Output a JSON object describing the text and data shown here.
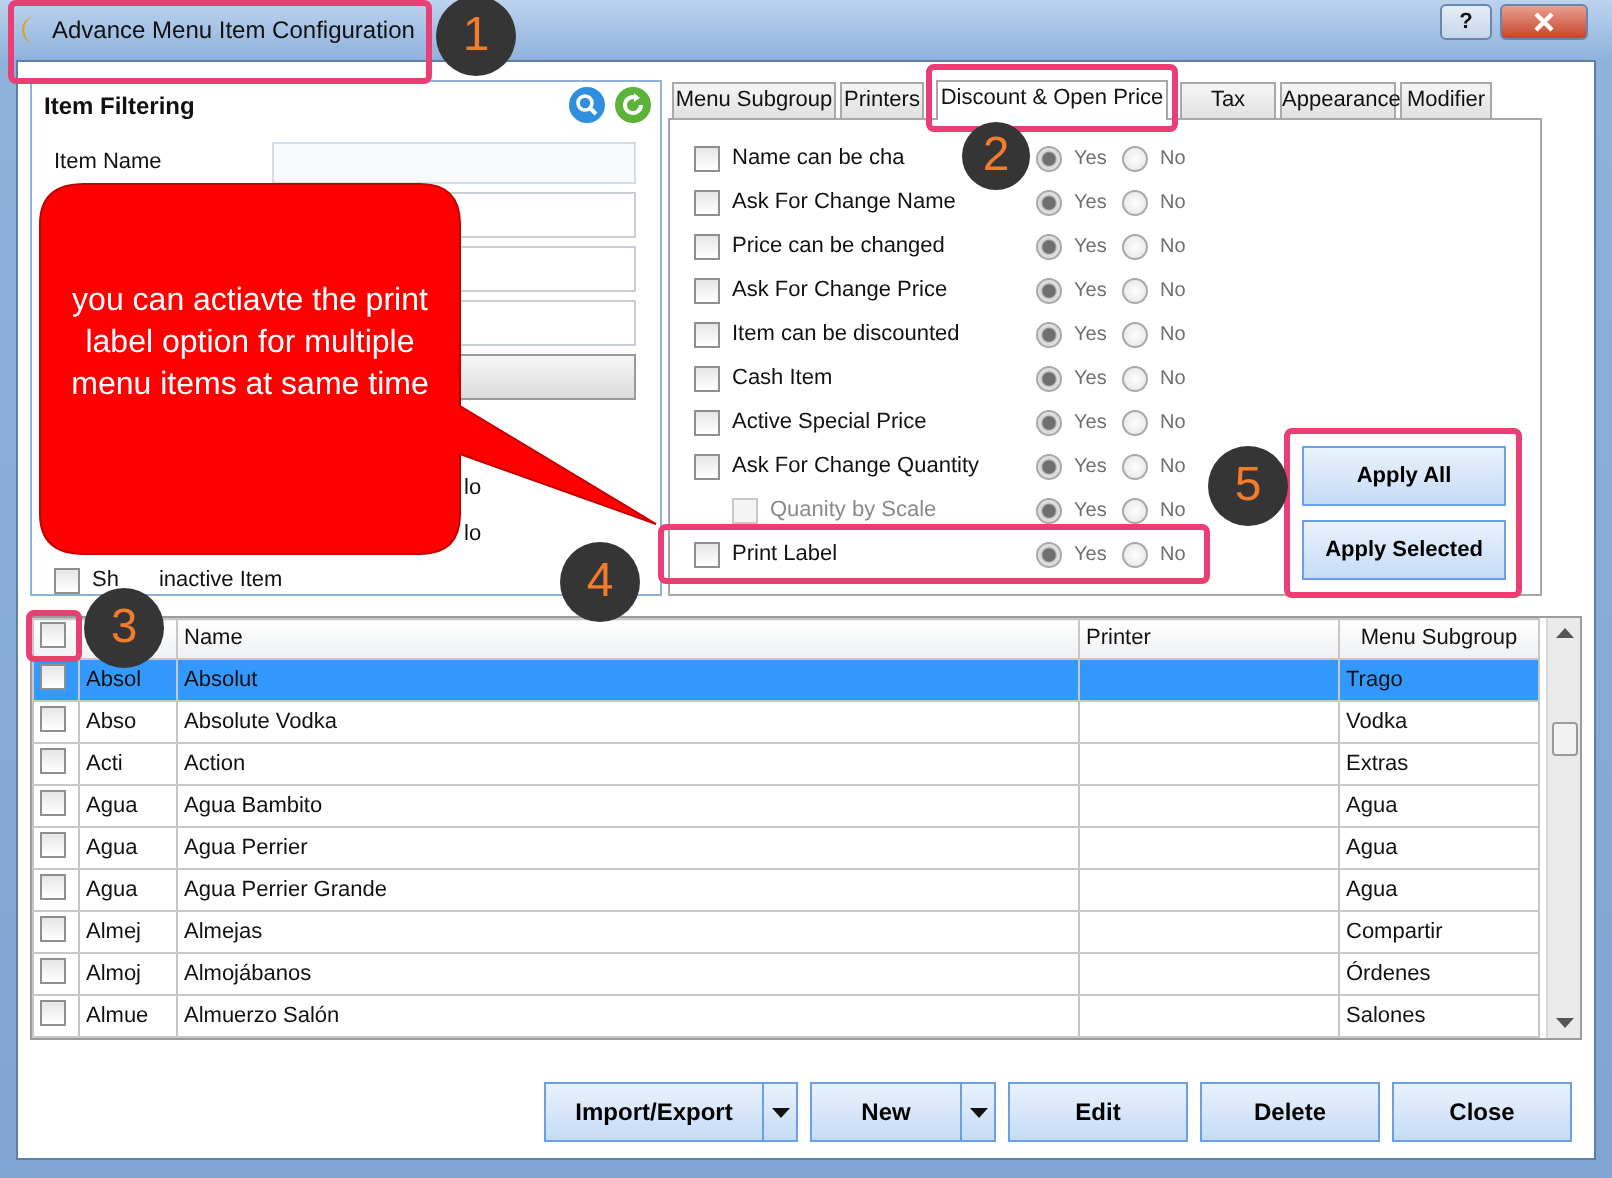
{
  "window": {
    "title": "Advance Menu Item Configuration",
    "help_label": "?"
  },
  "filter": {
    "title": "Item Filtering",
    "item_name_label": "Item Name",
    "fragments": [
      "lo",
      "lo"
    ],
    "show_inactive": {
      "label_start": "Sh",
      "label_end": "inactive Item",
      "checked": false
    }
  },
  "tabs": [
    {
      "label": "Menu Subgroup",
      "selected": false
    },
    {
      "label": "Printers",
      "selected": false
    },
    {
      "label": "Discount & Open Price",
      "selected": true
    },
    {
      "label": "Tax",
      "selected": false
    },
    {
      "label": "Appearance",
      "selected": false
    },
    {
      "label": "Modifier",
      "selected": false
    }
  ],
  "options": [
    {
      "label": "Name can be cha",
      "checked": false,
      "disabled": false,
      "indented": false,
      "yes_selected": true,
      "yes_label": "Yes",
      "no_label": "No"
    },
    {
      "label": "Ask For Change Name",
      "checked": false,
      "disabled": false,
      "indented": false,
      "yes_selected": true,
      "yes_label": "Yes",
      "no_label": "No"
    },
    {
      "label": "Price can be changed",
      "checked": false,
      "disabled": false,
      "indented": false,
      "yes_selected": true,
      "yes_label": "Yes",
      "no_label": "No"
    },
    {
      "label": "Ask For Change Price",
      "checked": false,
      "disabled": false,
      "indented": false,
      "yes_selected": true,
      "yes_label": "Yes",
      "no_label": "No"
    },
    {
      "label": "Item can be discounted",
      "checked": false,
      "disabled": false,
      "indented": false,
      "yes_selected": true,
      "yes_label": "Yes",
      "no_label": "No"
    },
    {
      "label": "Cash Item",
      "checked": false,
      "disabled": false,
      "indented": false,
      "yes_selected": true,
      "yes_label": "Yes",
      "no_label": "No"
    },
    {
      "label": "Active Special Price",
      "checked": false,
      "disabled": false,
      "indented": false,
      "yes_selected": true,
      "yes_label": "Yes",
      "no_label": "No"
    },
    {
      "label": "Ask For Change Quantity",
      "checked": false,
      "disabled": false,
      "indented": false,
      "yes_selected": true,
      "yes_label": "Yes",
      "no_label": "No"
    },
    {
      "label": "Quanity by Scale",
      "checked": false,
      "disabled": true,
      "indented": true,
      "yes_selected": true,
      "yes_label": "Yes",
      "no_label": "No"
    },
    {
      "label": "Print Label",
      "checked": false,
      "disabled": false,
      "indented": false,
      "yes_selected": true,
      "yes_label": "Yes",
      "no_label": "No"
    }
  ],
  "apply_buttons": [
    "Apply All",
    "Apply Selected"
  ],
  "table": {
    "header_checked": false,
    "columns": [
      "Name",
      "Printer",
      "Menu Subgroup"
    ],
    "rows": [
      {
        "alias": "Absol",
        "name": "Absolut",
        "subgroup": "Trago",
        "checked": false,
        "selected": true
      },
      {
        "alias": "Abso",
        "name": "Absolute Vodka",
        "subgroup": "Vodka",
        "checked": false,
        "selected": false
      },
      {
        "alias": "Acti",
        "name": "Action",
        "subgroup": "Extras",
        "checked": false,
        "selected": false
      },
      {
        "alias": "Agua",
        "name": "Agua Bambito",
        "subgroup": "Agua",
        "checked": false,
        "selected": false
      },
      {
        "alias": "Agua",
        "name": "Agua Perrier",
        "subgroup": "Agua",
        "checked": false,
        "selected": false
      },
      {
        "alias": "Agua",
        "name": "Agua Perrier Grande",
        "subgroup": "Agua",
        "checked": false,
        "selected": false
      },
      {
        "alias": "Almej",
        "name": "Almejas",
        "subgroup": "Compartir",
        "checked": false,
        "selected": false
      },
      {
        "alias": "Almoj",
        "name": "Almojábanos",
        "subgroup": "Órdenes",
        "checked": false,
        "selected": false
      },
      {
        "alias": "Almue",
        "name": "Almuerzo Salón",
        "subgroup": "Salones",
        "checked": false,
        "selected": false
      }
    ]
  },
  "buttons": [
    {
      "label": "Import/Export",
      "dropdown": true
    },
    {
      "label": "New",
      "dropdown": true
    },
    {
      "label": "Edit",
      "dropdown": false
    },
    {
      "label": "Delete",
      "dropdown": false
    },
    {
      "label": "Close",
      "dropdown": false
    }
  ],
  "annotations": {
    "callout": "you can actiavte the print label option for multiple menu items at same time",
    "steps": [
      "1",
      "2",
      "3",
      "4",
      "5"
    ]
  }
}
